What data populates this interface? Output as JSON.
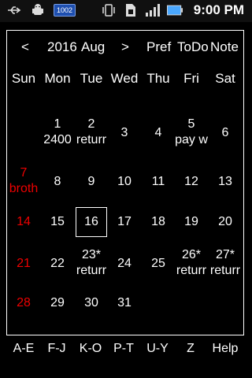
{
  "status": {
    "badge": "1002",
    "time": "9:00 PM"
  },
  "header": {
    "prev": "<",
    "year": "2016",
    "month": "Aug",
    "next": ">",
    "pref": "Pref",
    "todo": "ToDo",
    "note": "Note"
  },
  "weekdays": [
    "Sun",
    "Mon",
    "Tue",
    "Wed",
    "Thu",
    "Fri",
    "Sat"
  ],
  "cells": {
    "d1": "1",
    "d1n": "2400",
    "d2": "2",
    "d2n": "returr",
    "d3": "3",
    "d4": "4",
    "d5": "5",
    "d5n": "pay w",
    "d6": "6",
    "d7": "7",
    "d7n": "broth",
    "d8": "8",
    "d9": "9",
    "d10": "10",
    "d11": "11",
    "d12": "12",
    "d13": "13",
    "d14": "14",
    "d15": "15",
    "d16": "16",
    "d17": "17",
    "d18": "18",
    "d19": "19",
    "d20": "20",
    "d21": "21",
    "d22": "22",
    "d23": "23*",
    "d23n": "returr",
    "d24": "24",
    "d25": "25",
    "d26": "26*",
    "d26n": "returr",
    "d27": "27*",
    "d27n": "returr",
    "d28": "28",
    "d29": "29",
    "d30": "30",
    "d31": "31"
  },
  "bottom": [
    "A-E",
    "F-J",
    "K-O",
    "P-T",
    "U-Y",
    "Z",
    "Help"
  ]
}
